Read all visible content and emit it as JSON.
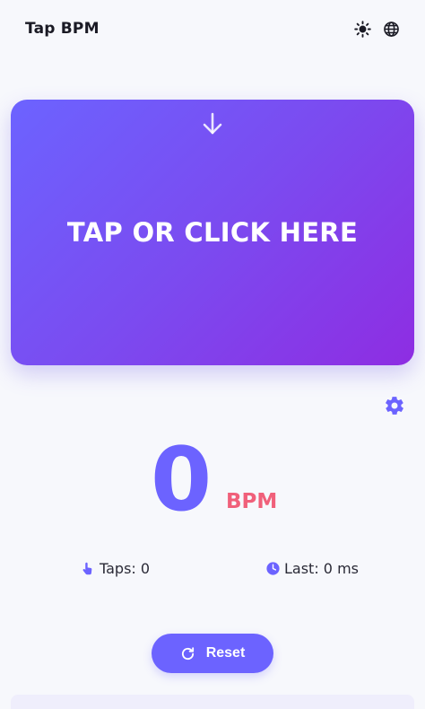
{
  "header": {
    "title": "Tap BPM",
    "icons": [
      "theme-toggle-icon",
      "language-globe-icon"
    ]
  },
  "tap_pad": {
    "label": "TAP OR CLICK HERE",
    "icon": "arrow-down-icon"
  },
  "settings": {
    "icon": "gear-icon"
  },
  "bpm": {
    "value": "0",
    "unit": "BPM"
  },
  "stats": {
    "taps_label": "Taps: 0",
    "last_label": "Last: 0 ms",
    "taps_icon": "hand-tap-icon",
    "last_icon": "clock-icon"
  },
  "reset": {
    "label": "Reset",
    "icon": "refresh-icon"
  },
  "colors": {
    "accent": "#6c63ff",
    "gradient_start": "#6c63ff",
    "gradient_end": "#8e2de2",
    "unit_pink": "#f0607a",
    "background": "#f7f8fc"
  }
}
